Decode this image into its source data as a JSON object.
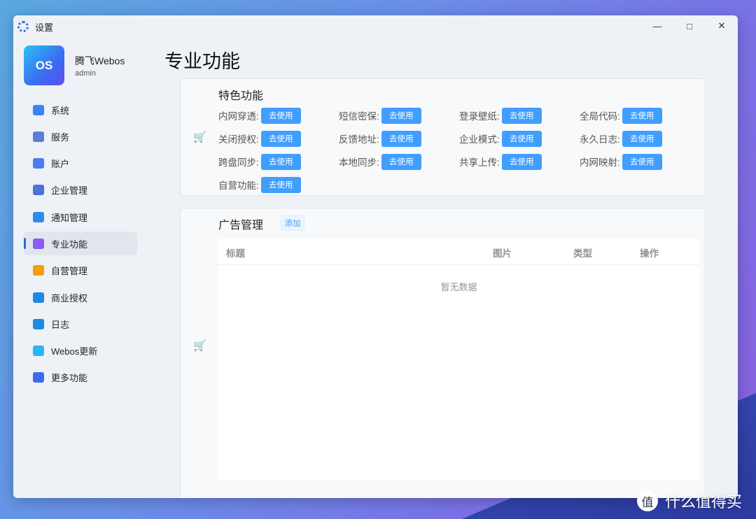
{
  "window": {
    "title": "设置",
    "controls": [
      "minimize",
      "maximize",
      "close"
    ]
  },
  "profile": {
    "logo_text": "OS",
    "name": "腾飞Webos",
    "user": "admin"
  },
  "sidebar": {
    "items": [
      {
        "label": "系统",
        "icon": "monitor-icon",
        "color": "#3b82f6"
      },
      {
        "label": "服务",
        "icon": "server-icon",
        "color": "#5b7fd6"
      },
      {
        "label": "账户",
        "icon": "user-edit-icon",
        "color": "#4a7ef0"
      },
      {
        "label": "企业管理",
        "icon": "business-user-icon",
        "color": "#4b74d8"
      },
      {
        "label": "通知管理",
        "icon": "bell-icon",
        "color": "#2d8cf0"
      },
      {
        "label": "专业功能",
        "icon": "medal-icon",
        "color": "#8b5cf6",
        "active": true
      },
      {
        "label": "自营管理",
        "icon": "card-stack-icon",
        "color": "#f59e0b"
      },
      {
        "label": "商业授权",
        "icon": "credit-card-icon",
        "color": "#1e88e5"
      },
      {
        "label": "日志",
        "icon": "document-icon",
        "color": "#1e88e5"
      },
      {
        "label": "Webos更新",
        "icon": "refresh-globe-icon",
        "color": "#29b6f6"
      },
      {
        "label": "更多功能",
        "icon": "list-icon",
        "color": "#3b6cf0"
      }
    ]
  },
  "page": {
    "title": "专业功能"
  },
  "features": {
    "title": "特色功能",
    "button_label": "去使用",
    "items": [
      "内网穿透:",
      "短信密保:",
      "登录壁纸:",
      "全局代码:",
      "关闭授权:",
      "反馈地址:",
      "企业模式:",
      "永久日志:",
      "跨盘同步:",
      "本地同步:",
      "共享上传:",
      "内网映射:",
      "自营功能:"
    ]
  },
  "ads": {
    "title": "广告管理",
    "add_label": "添加",
    "columns": [
      "标题",
      "图片",
      "类型",
      "操作"
    ],
    "empty_text": "暂无数据"
  },
  "watermark": {
    "badge": "值",
    "text": "什么值得买"
  }
}
